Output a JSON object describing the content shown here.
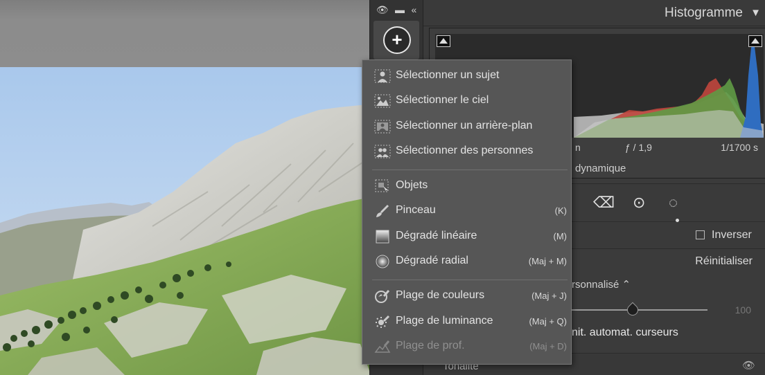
{
  "panel": {
    "title": "Histogramme",
    "collapse_arrow": "▼",
    "exif": {
      "left": "n",
      "aperture": "ƒ / 1,9",
      "shutter": "1/1700 s"
    },
    "histogram_sub_label": "dynamique"
  },
  "mask_strip": {
    "eye_icon": "eye-icon",
    "minus_icon": "minus-icon",
    "collapse_icon": "double-chevron-left-icon",
    "add_icon": "plus-icon"
  },
  "mask_options": {
    "inverser_label": "Inverser",
    "reset_label": "Réinitialiser",
    "preset_label": "rsonnalisé ⌃",
    "slider_value": "100",
    "auto_label": "nit. automat. curseurs",
    "section_label": "Tonalité"
  },
  "menu": {
    "group1": [
      {
        "label": "Sélectionner un sujet",
        "icon": "subject-icon",
        "shortcut": ""
      },
      {
        "label": "Sélectionner le ciel",
        "icon": "sky-icon",
        "shortcut": ""
      },
      {
        "label": "Sélectionner un arrière-plan",
        "icon": "background-icon",
        "shortcut": ""
      },
      {
        "label": "Sélectionner des personnes",
        "icon": "people-icon",
        "shortcut": ""
      }
    ],
    "group2": [
      {
        "label": "Objets",
        "icon": "objects-icon",
        "shortcut": ""
      },
      {
        "label": "Pinceau",
        "icon": "brush-icon",
        "shortcut": "(K)"
      },
      {
        "label": "Dégradé linéaire",
        "icon": "linear-gradient-icon",
        "shortcut": "(M)"
      },
      {
        "label": "Dégradé radial",
        "icon": "radial-gradient-icon",
        "shortcut": "(Maj + M)"
      }
    ],
    "group3": [
      {
        "label": "Plage de couleurs",
        "icon": "color-range-icon",
        "shortcut": "(Maj + J)"
      },
      {
        "label": "Plage de luminance",
        "icon": "luminance-range-icon",
        "shortcut": "(Maj + Q)"
      },
      {
        "label": "Plage de prof.",
        "icon": "depth-range-icon",
        "shortcut": "(Maj + D)",
        "disabled": true
      }
    ]
  }
}
